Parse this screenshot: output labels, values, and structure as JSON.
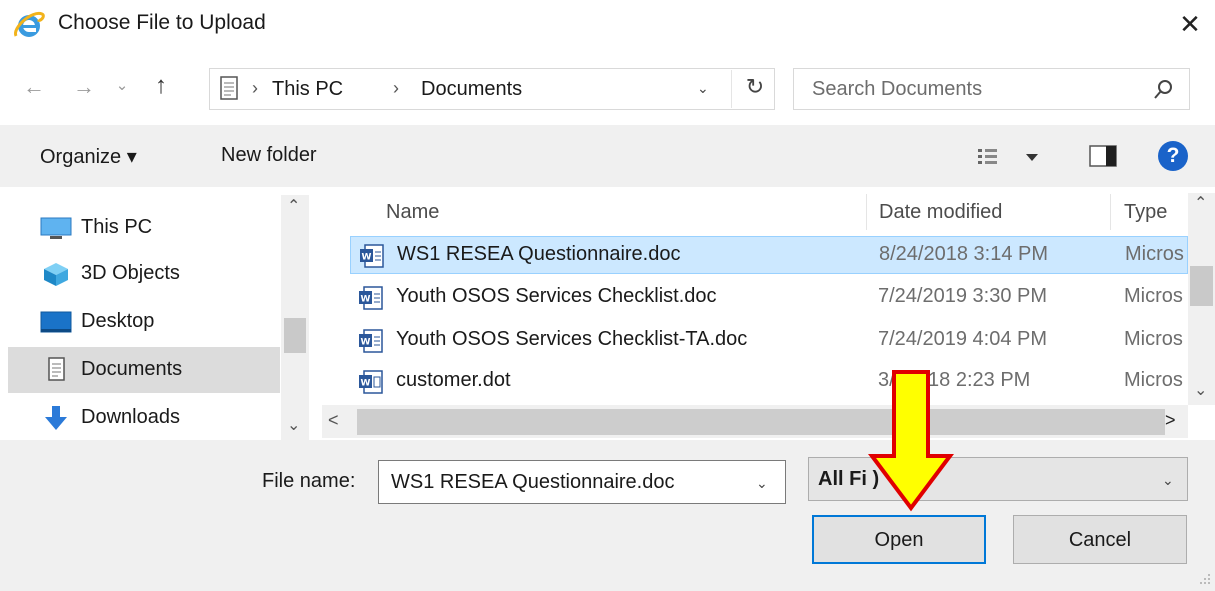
{
  "window": {
    "title": "Choose File to Upload",
    "close_glyph": "✕",
    "icon": "internet-explorer-icon"
  },
  "nav": {
    "back_glyph": "←",
    "forward_glyph": "→",
    "recent_glyph": "⌄",
    "up_glyph": "↑"
  },
  "address": {
    "crumbs": [
      "This PC",
      "Documents"
    ],
    "separator": "›",
    "dropdown_glyph": "⌄",
    "refresh_glyph": "↻"
  },
  "search": {
    "placeholder": "Search Documents",
    "icon": "search-icon"
  },
  "toolbar": {
    "organize_label": "Organize ▾",
    "new_folder_label": "New folder",
    "help_glyph": "?"
  },
  "sidebar": {
    "items": [
      {
        "label": "This PC",
        "icon": "computer-icon"
      },
      {
        "label": "3D Objects",
        "icon": "cube-icon"
      },
      {
        "label": "Desktop",
        "icon": "desktop-icon"
      },
      {
        "label": "Documents",
        "icon": "documents-icon",
        "selected": true
      },
      {
        "label": "Downloads",
        "icon": "download-icon"
      }
    ]
  },
  "filelist": {
    "columns": {
      "name": "Name",
      "date": "Date modified",
      "type": "Type"
    },
    "rows": [
      {
        "name": "WS1 RESEA Questionnaire.doc",
        "date": "8/24/2018 3:14 PM",
        "type": "Micros",
        "selected": true
      },
      {
        "name": "Youth OSOS  Services Checklist.doc",
        "date": "7/24/2019 3:30 PM",
        "type": "Micros"
      },
      {
        "name": "Youth OSOS  Services Checklist-TA.doc",
        "date": "7/24/2019 4:04 PM",
        "type": "Micros"
      },
      {
        "name": "customer.dot",
        "date": "3/  /2018 2:23 PM",
        "type": "Micros"
      }
    ]
  },
  "footer": {
    "file_name_label": "File name:",
    "file_name_value": "WS1 RESEA Questionnaire.doc",
    "file_type_value": "All Fi         )",
    "open_label": "Open",
    "cancel_label": "Cancel"
  },
  "colors": {
    "selection_bg": "#cce8ff",
    "selection_border": "#99d1ff",
    "accent": "#0078d7",
    "help_blue": "#1a63c9",
    "annotation_fill": "#ffff00",
    "annotation_stroke": "#e00000"
  }
}
